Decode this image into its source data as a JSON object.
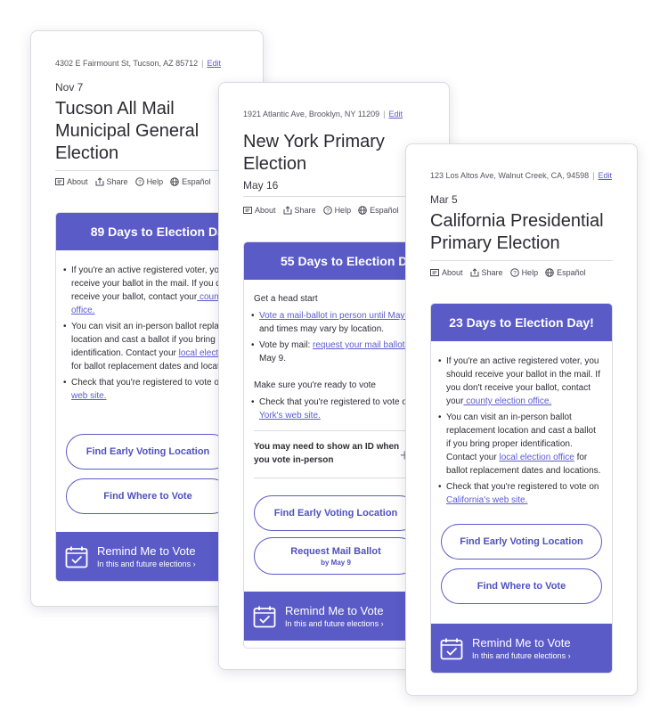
{
  "cards": [
    {
      "address": "4302 E Fairmount St, Tucson, AZ 85712",
      "separator": "|",
      "edit": "Edit",
      "date": "Nov 7",
      "title": "Tucson All Mail Municipal General Election",
      "meta": {
        "about": "About",
        "share": "Share",
        "help": "Help",
        "lang": "Español"
      },
      "countdown": "89 Days to Election Day!",
      "bullets": [
        {
          "pre": "If you're an active registered voter, you should receive your ballot in the mail. If you don't receive your ballot, contact your",
          "link": " county election office.",
          "post": ""
        },
        {
          "pre": "You can visit an in-person ballot replacement location and cast a ballot if you bring proper identification. Contact your ",
          "link": "local election office",
          "post": " for ballot replacement dates and locations."
        },
        {
          "pre": "Check that you're registered to vote on ",
          "link": "Arizona's web site.",
          "post": ""
        }
      ],
      "buttons": [
        "Find Early Voting Location",
        "Find Where to Vote"
      ],
      "remind": {
        "title": "Remind Me to Vote",
        "sub": "In this and future elections ›"
      }
    },
    {
      "address": "1921 Atlantic Ave, Brooklyn, NY 11209",
      "separator": "|",
      "edit": "Edit",
      "title": "New York Primary Election",
      "date": "May 16",
      "meta": {
        "about": "About",
        "share": "Share",
        "help": "Help",
        "lang": "Español"
      },
      "countdown": "55 Days to Election Day",
      "head_start": "Get a head start",
      "bullets_a": [
        {
          "pre": "",
          "link": "Vote a mail-ballot in person until May 9.",
          "post": " Dates and times may vary by location."
        },
        {
          "pre": "Vote by mail: ",
          "link": "request your mail ballot online",
          "post": " by May 9."
        }
      ],
      "ready": "Make sure you're ready to vote",
      "bullets_b": [
        {
          "pre": "Check that you're registered to vote on ",
          "link": "New York's web site.",
          "post": ""
        }
      ],
      "id_note": "You may need to show an ID when you vote in-person",
      "plus": "+",
      "buttons": [
        "Find Early Voting Location",
        "Request Mail Ballot"
      ],
      "button_sub": "by May 9",
      "remind": {
        "title": "Remind Me to Vote",
        "sub": "In this and future elections ›"
      }
    },
    {
      "address": "123 Los Altos Ave, Walnut Creek, CA, 94598",
      "separator": "|",
      "edit": "Edit",
      "date": "Mar 5",
      "title": "California Presidential Primary Election",
      "meta": {
        "about": "About",
        "share": "Share",
        "help": "Help",
        "lang": "Español"
      },
      "countdown": "23 Days to Election Day!",
      "bullets": [
        {
          "pre": "If you're an active registered voter, you should receive your ballot in the mail. If you don't receive your ballot, contact your",
          "link": " county election office.",
          "post": ""
        },
        {
          "pre": "You can visit an in-person ballot replacement location and cast a ballot if you bring proper identification. Contact your ",
          "link": "local election office",
          "post": " for ballot replacement dates and locations."
        },
        {
          "pre": "Check that you're registered to vote on ",
          "link": "California's web site.",
          "post": ""
        }
      ],
      "buttons": [
        "Find Early Voting Location",
        "Find Where to Vote"
      ],
      "remind": {
        "title": "Remind Me to Vote",
        "sub": "In this and future elections ›"
      }
    }
  ],
  "colors": {
    "accent": "#5b5bc8",
    "link": "#5b5bd0",
    "border": "#d9dbe3"
  }
}
